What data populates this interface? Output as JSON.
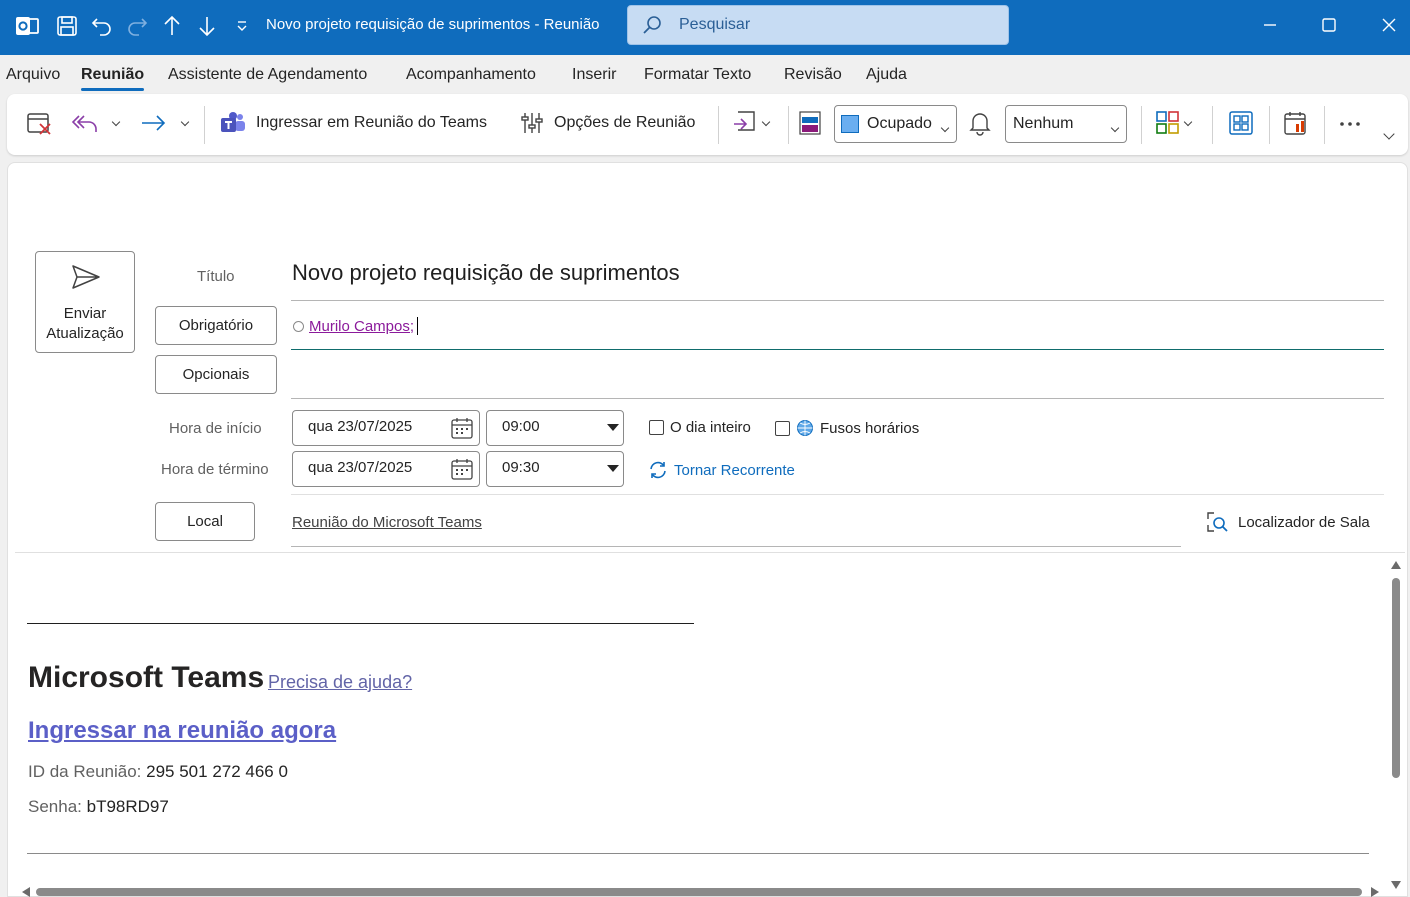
{
  "titlebar": {
    "title": "Novo projeto requisição de suprimentos  -  Reunião",
    "search_placeholder": "Pesquisar",
    "icons": [
      "outlook-icon",
      "save-icon",
      "undo-icon",
      "redo-icon",
      "up-arrow-icon",
      "down-arrow-icon",
      "customize-chevron-icon",
      "search-icon",
      "minimize-icon",
      "maximize-icon",
      "close-icon"
    ],
    "color": "#0f6cbd"
  },
  "menu": {
    "items": [
      "Arquivo",
      "Reunião",
      "Assistente de Agendamento",
      "Acompanhamento",
      "Inserir",
      "Formatar Texto",
      "Revisão",
      "Ajuda"
    ],
    "active": "Reunião"
  },
  "ribbon": {
    "teams_label": "Ingressar em Reunião do Teams",
    "options_label": "Opções de Reunião",
    "show_as_value": "Ocupado",
    "reminder_value": "Nenhum"
  },
  "form": {
    "send_label": "Enviar Atualização",
    "title_label": "Título",
    "title_value": "Novo projeto requisição de suprimentos",
    "required_label": "Obrigatório",
    "optional_label": "Opcionais",
    "attendee": "Murilo Campos;",
    "start_label": "Hora de início",
    "end_label": "Hora de término",
    "start_date": "qua 23/07/2025",
    "start_time": "09:00",
    "end_date": "qua 23/07/2025",
    "end_time": "09:30",
    "all_day_label": "O dia inteiro",
    "timezones_label": "Fusos horários",
    "recurring_label": "Tornar Recorrente",
    "location_button": "Local",
    "location_value": "Reunião do Microsoft Teams",
    "room_finder_label": "Localizador de Sala"
  },
  "body": {
    "separator": "________________________________________________________________________________",
    "teams_title": "Microsoft Teams",
    "help_link": "Precisa de ajuda?",
    "join_link": "Ingressar na reunião agora",
    "meeting_id_label": "ID da Reunião: ",
    "meeting_id_value": "295 501 272 466 0",
    "password_label": "Senha: ",
    "password_value": "bT98RD97",
    "link_color": "#5b5fc7"
  }
}
